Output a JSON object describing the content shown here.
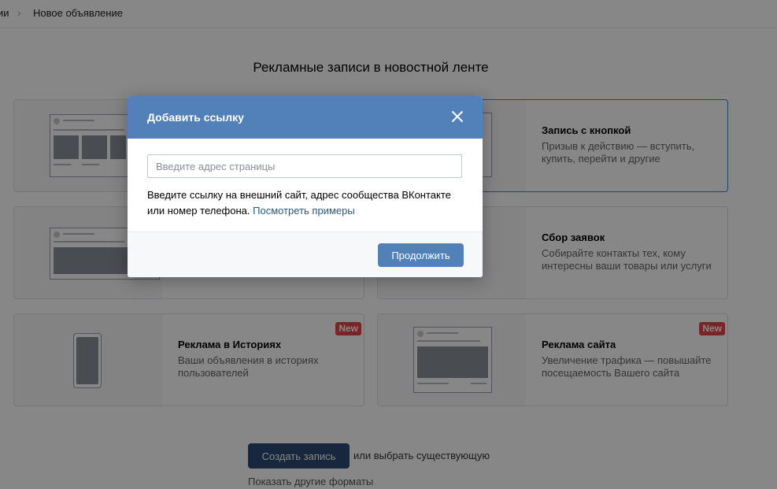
{
  "breadcrumb": {
    "previous": "ии",
    "separator": "›",
    "current": "Новое объявление"
  },
  "section_title": "Рекламные записи в новостной ленте",
  "cards": [
    {
      "title": "Запись с кнопкой",
      "description": "Призыв к действию — вступить, купить, перейти и другие"
    },
    {
      "title": "Сбор заявок",
      "description": "Собирайте контакты тех, кому интересны ваши товары или услуги"
    },
    {
      "title": "Реклама в Историях",
      "description": "Ваши объявления в историях пользователей",
      "badge": "New"
    },
    {
      "title": "Реклама сайта",
      "description": "Увеличение трафика — повышайте посещаемость Вашего сайта",
      "badge": "New"
    }
  ],
  "bottom": {
    "create_button": "Создать запись",
    "or_choose": "или выбрать существующую",
    "other_formats": "Показать другие форматы"
  },
  "modal": {
    "title": "Добавить ссылку",
    "input_placeholder": "Введите адрес страницы",
    "input_value": "",
    "hint_text": "Введите ссылку на внешний сайт, адрес сообщества ВКонтакте или номер телефона.",
    "hint_link": "Посмотреть примеры",
    "continue_button": "Продолжить"
  },
  "colors": {
    "accent": "#5181b8",
    "dark_button": "#2a4a75",
    "badge": "#e64646",
    "link": "#2a5885"
  }
}
